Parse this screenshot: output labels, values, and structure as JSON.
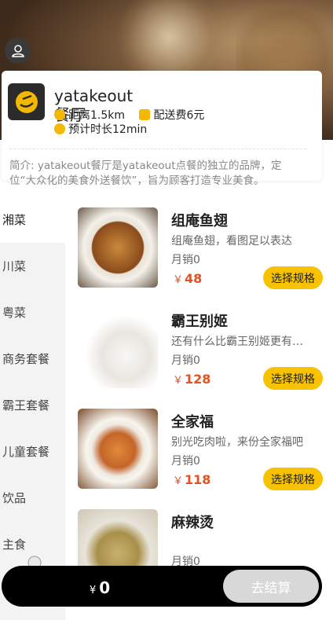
{
  "shop": {
    "name": "yatakeout餐厅",
    "distance": "距离1.5km",
    "delivery_fee": "配送费6元",
    "eta": "预计时长12min",
    "intro": "简介: yatakeout餐厅是yatakeout点餐的独立的品牌，定位“大众化的美食外送餐饮”，旨为顾客打造专业美食。"
  },
  "categories": [
    "湘菜",
    "川菜",
    "粤菜",
    "商务套餐",
    "霸王套餐",
    "儿童套餐",
    "饮品",
    "主食"
  ],
  "active_category": "湘菜",
  "products": [
    {
      "name": "组庵鱼翅",
      "desc": "组庵鱼翅，看图足以表达",
      "sales": "月销0",
      "price": "48",
      "button": "选择规格"
    },
    {
      "name": "霸王别姬",
      "desc": "还有什么比霸王别姬更有魅力",
      "sales": "月销0",
      "price": "128",
      "button": "选择规格"
    },
    {
      "name": "全家福",
      "desc": "别光吃肉啦，来份全家福吧",
      "sales": "月销0",
      "price": "118",
      "button": "选择规格"
    },
    {
      "name": "麻辣烫",
      "desc": "",
      "sales": "月销0",
      "price": "",
      "button": ""
    }
  ],
  "currency": "￥",
  "cart": {
    "total": "0",
    "currency": "¥",
    "checkout_label": "去结算"
  },
  "colors": {
    "accent": "#f7c200",
    "price": "#e8501e",
    "cart_bg": "#000000"
  }
}
